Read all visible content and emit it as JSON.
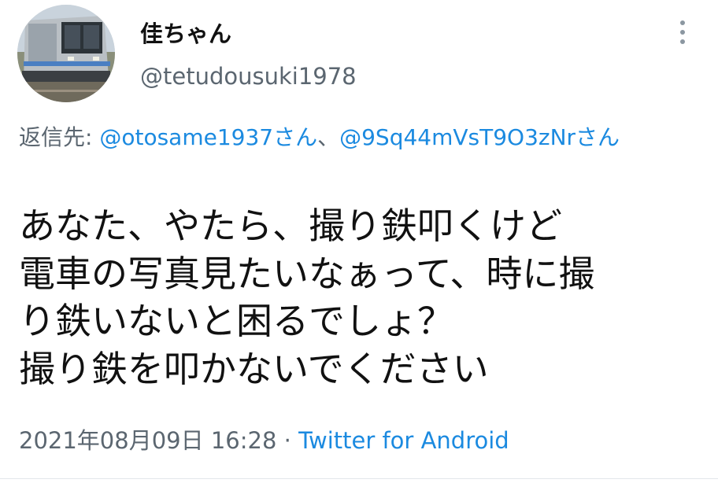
{
  "tweet": {
    "author": {
      "name": "佳ちゃん",
      "handle": "@tetudousuki1978",
      "avatar_icon": "train-photo-avatar"
    },
    "more_icon": "more-vertical-icon",
    "reply": {
      "prefix": "返信先: ",
      "mention_1": "@otosame1937さん",
      "separator": "、",
      "mention_2": "@9Sq44mVsT9O3zNrさん"
    },
    "body_lines": [
      "あなた、やたら、撮り鉄叩くけど",
      "電車の写真見たいなぁって、時に撮",
      "り鉄いないと困るでしょ？",
      "撮り鉄を叩かないでください"
    ],
    "timestamp": "2021年08月09日 16:28",
    "meta_separator": " · ",
    "source": "Twitter for Android"
  },
  "colors": {
    "link": "#1b8ae0",
    "secondary_text": "#5b6670",
    "primary_text": "#111111"
  }
}
